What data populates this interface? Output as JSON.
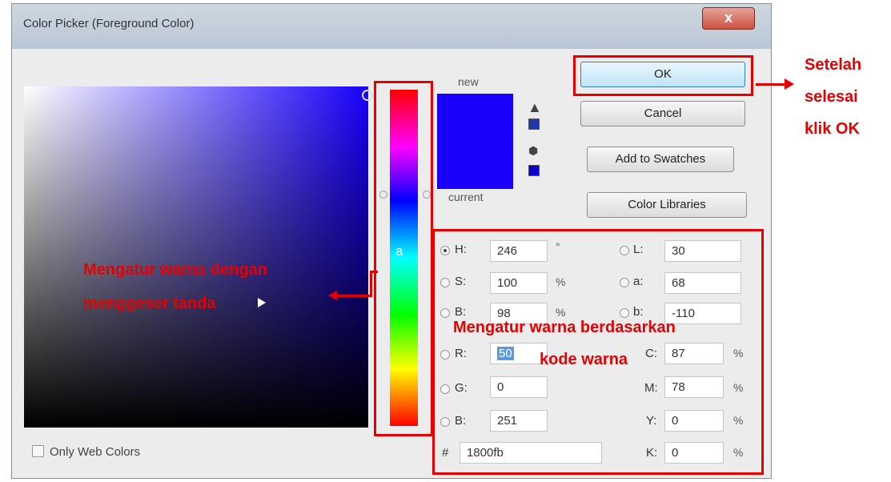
{
  "window": {
    "title": "Color Picker (Foreground Color)",
    "close_label": "x"
  },
  "preview": {
    "new_label": "new",
    "current_label": "current",
    "color": "#1800fb"
  },
  "buttons": {
    "ok": "OK",
    "cancel": "Cancel",
    "add_swatches": "Add to Swatches",
    "color_libraries": "Color Libraries"
  },
  "hue_slider_label": "a",
  "fields": {
    "H": {
      "label": "H:",
      "value": "246",
      "unit": "°"
    },
    "S": {
      "label": "S:",
      "value": "100",
      "unit": "%"
    },
    "B": {
      "label": "B:",
      "value": "98",
      "unit": "%"
    },
    "R": {
      "label": "R:",
      "value": "50"
    },
    "G": {
      "label": "G:",
      "value": "0"
    },
    "Bl": {
      "label": "B:",
      "value": "251"
    },
    "L": {
      "label": "L:",
      "value": "30"
    },
    "a": {
      "label": "a:",
      "value": "68"
    },
    "b": {
      "label": "b:",
      "value": "-110"
    },
    "C": {
      "label": "C:",
      "value": "87",
      "unit": "%"
    },
    "M": {
      "label": "M:",
      "value": "78",
      "unit": "%"
    },
    "Y": {
      "label": "Y:",
      "value": "0",
      "unit": "%"
    },
    "K": {
      "label": "K:",
      "value": "0",
      "unit": "%"
    },
    "hex": {
      "label": "#",
      "value": "1800fb"
    }
  },
  "only_web_colors": "Only Web Colors",
  "annotations": {
    "ok_note_1": "Setelah",
    "ok_note_2": "selesai",
    "ok_note_3": "klik OK",
    "slider_note_1": "Mengatur warna dengan",
    "slider_note_2": "menggeser tanda",
    "values_note_1": "Mengatur warna berdasarkan",
    "values_note_2": "kode warna"
  }
}
